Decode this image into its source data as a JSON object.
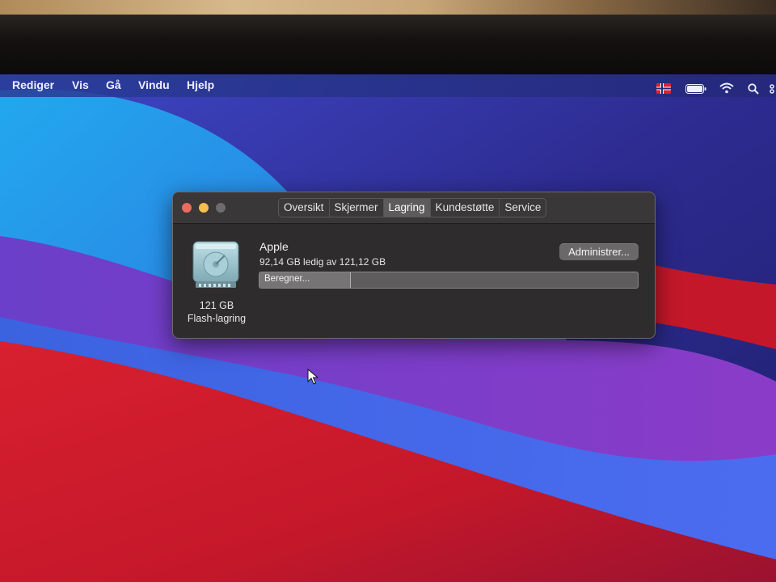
{
  "menubar": {
    "items": [
      "Rediger",
      "Vis",
      "Gå",
      "Vindu",
      "Hjelp"
    ],
    "status_icons": [
      "norway-flag-icon",
      "battery-icon",
      "wifi-icon",
      "spotlight-search-icon",
      "control-center-icon"
    ]
  },
  "window": {
    "tabs": [
      {
        "label": "Oversikt",
        "active": false
      },
      {
        "label": "Skjermer",
        "active": false
      },
      {
        "label": "Lagring",
        "active": true
      },
      {
        "label": "Kundestøtte",
        "active": false
      },
      {
        "label": "Service",
        "active": false
      }
    ],
    "disk": {
      "size": "121 GB",
      "type": "Flash-lagring"
    },
    "volume": {
      "name": "Apple",
      "free_text": "92,14 GB ledig av 121,12 GB",
      "status": "Beregner...",
      "used_fraction": 0.24
    },
    "manage_button": "Administrer..."
  },
  "colors": {
    "close": "#ed6a5e",
    "minimize": "#f5bf4f",
    "zoom_inactive": "#6e6b6c",
    "window_bg": "#2f2c2d"
  }
}
